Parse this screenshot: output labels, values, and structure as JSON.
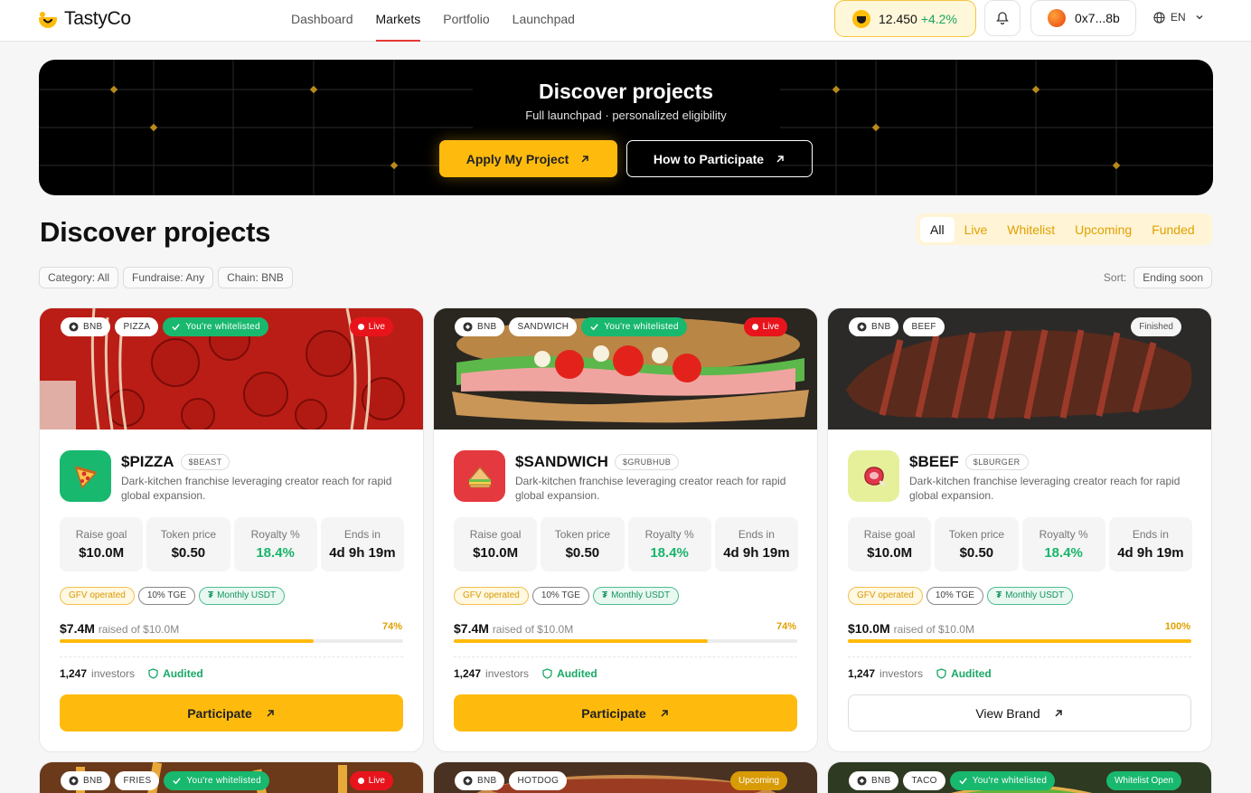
{
  "nav": {
    "brand": "TastyCo",
    "links": [
      {
        "label": "Dashboard",
        "active": false
      },
      {
        "label": "Markets",
        "active": true
      },
      {
        "label": "Portfolio",
        "active": false
      },
      {
        "label": "Launchpad",
        "active": false
      }
    ],
    "balance": "12.450",
    "balance_change": "+4.2%",
    "wallet": "0x7...8b",
    "language": "EN"
  },
  "hero": {
    "title": "Discover projects",
    "subtitle": "Full launchpad · personalized eligibility",
    "apply_label": "Apply My Project",
    "how_label": "How to Participate"
  },
  "section": {
    "title": "Discover projects",
    "tabs": [
      "All",
      "Live",
      "Whitelist",
      "Upcoming",
      "Funded"
    ],
    "active_tab": "All",
    "filters": [
      "Category: All",
      "Fundraise: Any",
      "Chain: BNB"
    ],
    "sort_label": "Sort:",
    "sort_value": "Ending soon"
  },
  "cards": [
    {
      "chain": "BNB",
      "category": "PIZZA",
      "whitelisted": "You're whitelisted",
      "status": "Live",
      "name": "$PIZZA",
      "ticker": "$BEAST",
      "desc": "Dark-kitchen franchise leveraging creator reach for rapid global expansion.",
      "stats": [
        {
          "label": "Raise goal",
          "value": "$10.0M"
        },
        {
          "label": "Token price",
          "value": "$0.50"
        },
        {
          "label": "Royalty %",
          "value": "18.4%"
        },
        {
          "label": "Ends in",
          "value": "4d 9h 19m"
        }
      ],
      "badges": [
        "GFV operated",
        "10% TGE",
        "Monthly USDT"
      ],
      "raised": "$7.4M",
      "raised_of": "raised of $10.0M",
      "pct": "74%",
      "progress": 0.74,
      "investors": "1,247",
      "investors_label": "investors",
      "audited": "Audited",
      "cta": "Participate"
    },
    {
      "chain": "BNB",
      "category": "SANDWICH",
      "whitelisted": "You're whitelisted",
      "status": "Live",
      "name": "$SANDWICH",
      "ticker": "$GRUBHUB",
      "desc": "Dark-kitchen franchise leveraging creator reach for rapid global expansion.",
      "stats": [
        {
          "label": "Raise goal",
          "value": "$10.0M"
        },
        {
          "label": "Token price",
          "value": "$0.50"
        },
        {
          "label": "Royalty %",
          "value": "18.4%"
        },
        {
          "label": "Ends in",
          "value": "4d 9h 19m"
        }
      ],
      "badges": [
        "GFV operated",
        "10% TGE",
        "Monthly USDT"
      ],
      "raised": "$7.4M",
      "raised_of": "raised of $10.0M",
      "pct": "74%",
      "progress": 0.74,
      "investors": "1,247",
      "investors_label": "investors",
      "audited": "Audited",
      "cta": "Participate"
    },
    {
      "chain": "BNB",
      "category": "BEEF",
      "whitelisted": "",
      "status": "Finished",
      "name": "$BEEF",
      "ticker": "$LBURGER",
      "desc": "Dark-kitchen franchise leveraging creator reach for rapid global expansion.",
      "stats": [
        {
          "label": "Raise goal",
          "value": "$10.0M"
        },
        {
          "label": "Token price",
          "value": "$0.50"
        },
        {
          "label": "Royalty %",
          "value": "18.4%"
        },
        {
          "label": "Ends in",
          "value": "4d 9h 19m"
        }
      ],
      "badges": [
        "GFV operated",
        "10% TGE",
        "Monthly USDT"
      ],
      "raised": "$10.0M",
      "raised_of": "raised of $10.0M",
      "pct": "100%",
      "progress": 1.0,
      "investors": "1,247",
      "investors_label": "investors",
      "audited": "Audited",
      "cta": "View Brand"
    }
  ],
  "next_row": [
    {
      "chain": "BNB",
      "category": "FRIES",
      "whitelisted": "You're whitelisted",
      "status": "Live"
    },
    {
      "chain": "BNB",
      "category": "HOTDOG",
      "whitelisted": "",
      "status": "Upcoming"
    },
    {
      "chain": "BNB",
      "category": "TACO",
      "whitelisted": "You're whitelisted",
      "status": "Whitelist Open"
    }
  ],
  "colors": {
    "accent": "#ffbb0d",
    "live": "#e8141c",
    "green": "#19b86f"
  }
}
